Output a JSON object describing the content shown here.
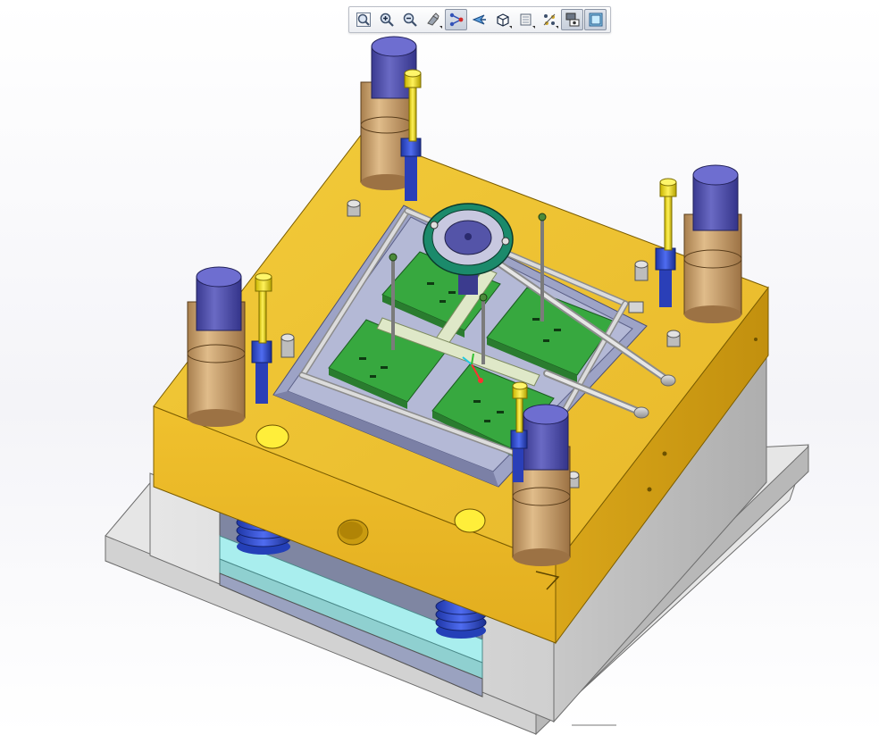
{
  "toolbar": {
    "tools": [
      {
        "id": "fit-all",
        "icon": "fit-all-icon",
        "active": false,
        "dropdown": false
      },
      {
        "id": "zoom-in",
        "icon": "zoom-in-icon",
        "active": false,
        "dropdown": false
      },
      {
        "id": "zoom-out",
        "icon": "zoom-out-icon",
        "active": false,
        "dropdown": false
      },
      {
        "id": "rotate",
        "icon": "rotate-view-icon",
        "active": false,
        "dropdown": true
      },
      {
        "id": "normal-view",
        "icon": "normal-view-icon",
        "active": true,
        "dropdown": false
      },
      {
        "id": "fly-mode",
        "icon": "fly-mode-icon",
        "active": false,
        "dropdown": false
      },
      {
        "id": "quick-view",
        "icon": "iso-view-cube-icon",
        "active": false,
        "dropdown": true
      },
      {
        "id": "view-mode",
        "icon": "render-style-icon",
        "active": false,
        "dropdown": true
      },
      {
        "id": "hide-show",
        "icon": "hide-show-icon",
        "active": false,
        "dropdown": true
      },
      {
        "id": "swap-visible",
        "icon": "swap-visible-space-icon",
        "active": true,
        "dropdown": false
      },
      {
        "id": "shading",
        "icon": "shading-icon",
        "active": true,
        "dropdown": false
      }
    ]
  },
  "model": {
    "description_colors": {
      "clamp_plate": "#f1c62f",
      "plate_shadow": "#c79b15",
      "mold_base": "#d7d7d7",
      "base_plate": "#e2e2e2",
      "cavity_green": "#2f9b3a",
      "locating_ring": "#1f8a6a",
      "guide_pillar_cap": "#4a4aa8",
      "guide_bushing": "#c9a06a",
      "ejector_plate": "#9ee6e6",
      "ejector_spring": "#2f4fc9",
      "runner_plate": "#9aa0c8"
    }
  }
}
